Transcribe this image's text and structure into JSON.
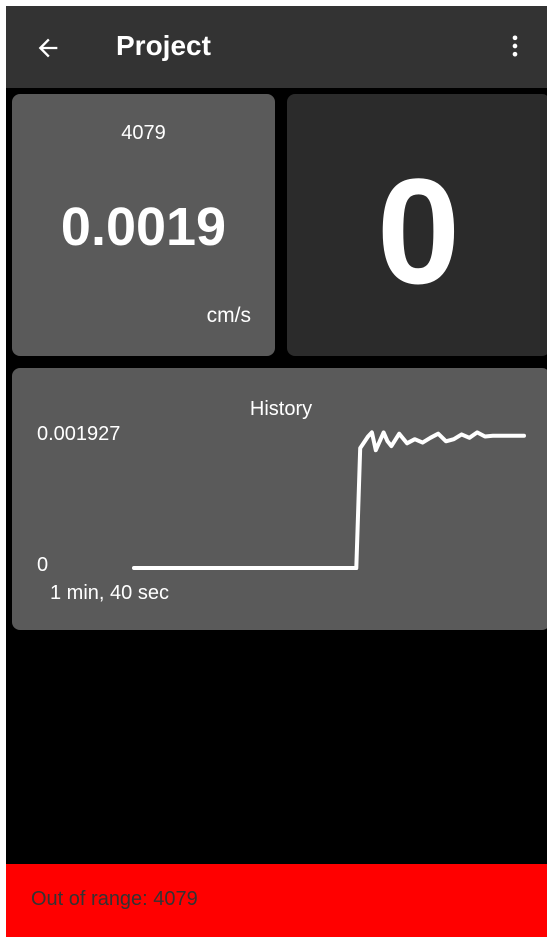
{
  "app_bar": {
    "title": "Project",
    "back_icon": "arrow-left-icon",
    "menu_icon": "more-vert-icon"
  },
  "reading": {
    "sensor_id": "4079",
    "value": "0.0019",
    "unit": "cm/s"
  },
  "count": {
    "value": "0"
  },
  "history": {
    "title": "History",
    "y_max_label": "0.001927",
    "y_min_label": "0",
    "time_span": "1 min, 40 sec"
  },
  "status": {
    "message": "Out of range: 4079"
  },
  "colors": {
    "status_background": "#ff0000",
    "card_background": "#5a5a5a",
    "count_card_background": "#2b2b2b",
    "app_bar_background": "#333333"
  },
  "chart_data": {
    "type": "line",
    "title": "History",
    "xlabel": "1 min, 40 sec",
    "ylabel": "",
    "ylim": [
      0,
      0.001927
    ],
    "x": [
      0,
      5,
      10,
      15,
      20,
      25,
      30,
      35,
      40,
      45,
      50,
      55,
      57,
      58,
      60,
      61,
      62,
      64,
      65,
      66,
      68,
      70,
      72,
      74,
      76,
      78,
      80,
      82,
      84,
      86,
      88,
      90,
      92,
      94,
      96,
      98,
      100
    ],
    "series": [
      {
        "values": [
          0,
          0,
          0,
          0,
          0,
          0,
          0,
          0,
          0,
          0,
          0,
          0,
          0,
          0.00175,
          0.00192,
          0.00198,
          0.00172,
          0.00198,
          0.00185,
          0.00178,
          0.00196,
          0.00182,
          0.00188,
          0.00183,
          0.0019,
          0.00196,
          0.00185,
          0.00188,
          0.00195,
          0.0019,
          0.00198,
          0.00192,
          0.00193,
          0.00193,
          0.00193,
          0.00193,
          0.00193
        ]
      }
    ]
  }
}
